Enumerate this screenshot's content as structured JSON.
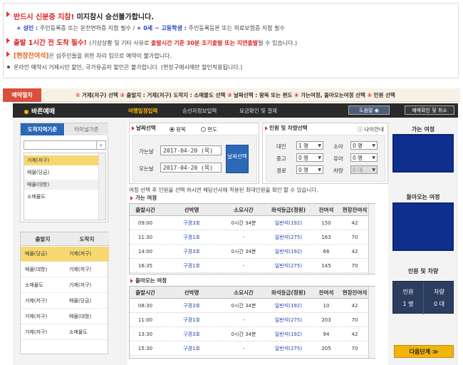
{
  "notice": {
    "line1": {
      "a": "반드시 신분증 지참! ",
      "b": "미지참시 승선불가합니다."
    },
    "line2": {
      "a": "+ 성인 : ",
      "b": "주민등록증 또는 운전면허증 지참 필수 / ",
      "c": "+ 0세 ~ 고등학생 : ",
      "d": "주민등록등본 또는 의료보험증 지참 필수"
    },
    "line3": {
      "a": "출발 1시간 전 도착 필수! ",
      "b": "(기상상황 및 기타 사유로 ",
      "c": "출발시간 기준 30분 조기출발 또는 지연출발",
      "d": "될 수 있습니다.)"
    },
    "line4": {
      "a": "[현장잔여석]",
      "b": "은 섬주민들을 위한 자리 임으로 예약이 불가합니다."
    },
    "line5": "온라인 예약시 거제시민 할인, 국가유공자 할인은 불가합니다. (현장구매시에만 할인적용됩니다.)"
  },
  "steps": {
    "label": "예약절차",
    "items": [
      {
        "n": "①",
        "t": "거제(저구) 선택"
      },
      {
        "n": "②",
        "t": "출발지 : 거제(저구) 도착지 : 소매물도 선택"
      },
      {
        "n": "③",
        "t": "날짜선택 : 왕복 또는 편도"
      },
      {
        "n": "④",
        "t": "가는여정, 돌아오는여정 선택"
      },
      {
        "n": "⑤",
        "t": "인원 선택"
      }
    ]
  },
  "topbar": {
    "brand": "바른예매",
    "nav": [
      "여행일정입력",
      "승선자정보입력",
      "요금확인 및 결제"
    ],
    "help": "도움말",
    "confirm": "예매확인 및 취소"
  },
  "left": {
    "tab_on": "도착지역기준",
    "tab_off": "터미널기준",
    "search_icon": "search-icon",
    "items": [
      "거제(저구)",
      "매물(당금)",
      "매물(대항)",
      "소매물도"
    ],
    "route_headers": [
      "출발지",
      "도착지"
    ],
    "routes": [
      [
        "매물(당금)",
        "거제(저구)"
      ],
      [
        "매물(대항)",
        "거제(저구)"
      ],
      [
        "소매물도",
        "거제(저구)"
      ],
      [
        "거제(저구)",
        "매물(당금)"
      ],
      [
        "거제(저구)",
        "매물(대항)"
      ],
      [
        "거제(저구)",
        "소매물도"
      ]
    ]
  },
  "date": {
    "title": "날짜선택",
    "round": "왕복",
    "oneway": "편도",
    "go_label": "가는날",
    "go_value": "2017-04-20 (목)",
    "return_label": "오는날",
    "return_value": "2017-04-20 (목)",
    "btn": "날짜선택"
  },
  "pax": {
    "title": "인원 및 차량선택",
    "age_link": "나이안내",
    "rows": [
      {
        "l1": "대인",
        "v1": "1 명",
        "l2": "소아",
        "v2": "0 명"
      },
      {
        "l1": "중고",
        "v1": "0 명",
        "l2": "유아",
        "v2": "0 명"
      },
      {
        "l1": "경로",
        "v1": "0 명",
        "l2": "차량",
        "v2": "0 대"
      }
    ]
  },
  "note": "여정 선택 후 인원을 선택 하시면 해당선사에 적용된 최대인원을 확인 할 수 있습니다.",
  "outbound": {
    "title": "가는 여정",
    "headers": [
      "출발시간",
      "선박명",
      "소요시간",
      "좌석등급(정원)",
      "잔여석",
      "현장잔여석"
    ],
    "rows": [
      [
        "09:00",
        "구경3호",
        "0시간 34분",
        "일반석(192)",
        "150",
        "42"
      ],
      [
        "11:30",
        "구경1호",
        "-",
        "일반석(275)",
        "163",
        "70"
      ],
      [
        "14:00",
        "구경3호",
        "0시간 34분",
        "일반석(192)",
        "66",
        "42"
      ],
      [
        "16:35",
        "구경1호",
        "-",
        "일반석(275)",
        "145",
        "70"
      ]
    ]
  },
  "inbound": {
    "title": "돌아오는 여정",
    "headers": [
      "출발시간",
      "선박명",
      "소요시간",
      "좌석등급(정원)",
      "잔여석",
      "현장잔여석"
    ],
    "rows": [
      [
        "08:30",
        "구경3호",
        "0시간 34분",
        "일반석(192)",
        "10",
        "42"
      ],
      [
        "11:00",
        "구경1호",
        "-",
        "일반석(275)",
        "203",
        "70"
      ],
      [
        "13:30",
        "구경3호",
        "0시간 34분",
        "일반석(192)",
        "94",
        "42"
      ],
      [
        "15:30",
        "구경1호",
        "-",
        "일반석(275)",
        "205",
        "70"
      ]
    ]
  },
  "right": {
    "go_title": "가는 여정",
    "return_title": "돌아오는 여정",
    "pax_title": "인원 및 차량",
    "adult_label": "인원",
    "adult_value": "1 명",
    "car_label": "차량",
    "car_value": "0 대",
    "next": "다음단계 ≫"
  },
  "colors": {
    "accent": "#2b68b5",
    "warning": "#d22222",
    "highlight": "#f7d870",
    "brand_bar": "#2a2a2a"
  }
}
